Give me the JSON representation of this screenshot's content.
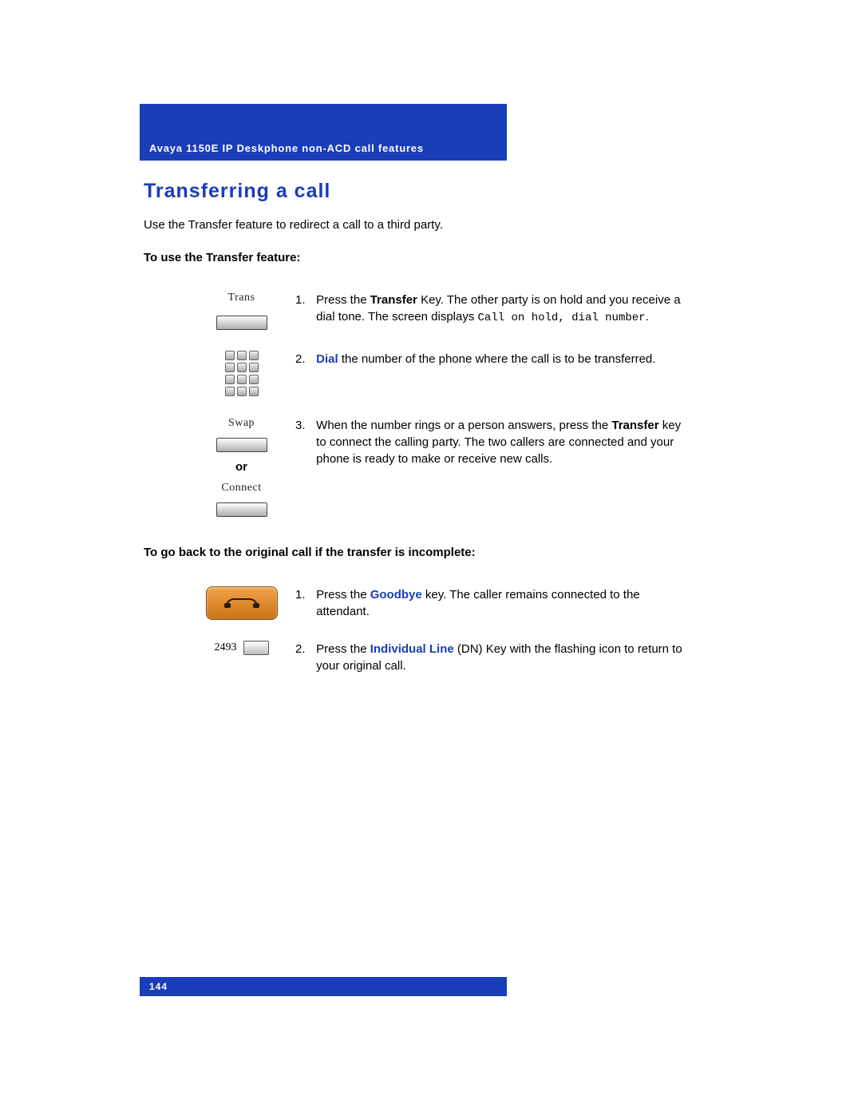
{
  "header": "Avaya 1150E IP Deskphone non-ACD call features",
  "title": "Transferring a call",
  "intro": "Use the Transfer feature to redirect a call to a third party.",
  "section1_head": "To use the Transfer feature:",
  "steps1": {
    "trans_label": "Trans",
    "swap_label": "Swap",
    "connect_label": "Connect",
    "or": "or",
    "s1_num": "1.",
    "s1_a": "Press the ",
    "s1_b": "Transfer",
    "s1_c": " Key. The other party is on hold and you receive a dial tone. The screen displays ",
    "s1_mono": "Call on hold, dial number",
    "s1_d": ".",
    "s2_num": "2.",
    "s2_a": "Dial",
    "s2_b": " the number of the phone where the call is to be transferred.",
    "s3_num": "3.",
    "s3_a": "When the number rings or a person answers, press the ",
    "s3_b": "Transfer",
    "s3_c": " key to connect the calling party. The two callers are connected and your phone is ready to make or receive new calls."
  },
  "section2_head": "To go back to the original call if the transfer is incomplete:",
  "steps2": {
    "s1_num": "1.",
    "s1_a": "Press the ",
    "s1_b": "Goodbye",
    "s1_c": " key. The caller remains connected to the attendant.",
    "s2_num": "2.",
    "s2_a": "Press the ",
    "s2_b": "Individual Line",
    "s2_c": " (DN) Key with the flashing icon to return to your original call.",
    "dn": "2493"
  },
  "page_number": "144"
}
